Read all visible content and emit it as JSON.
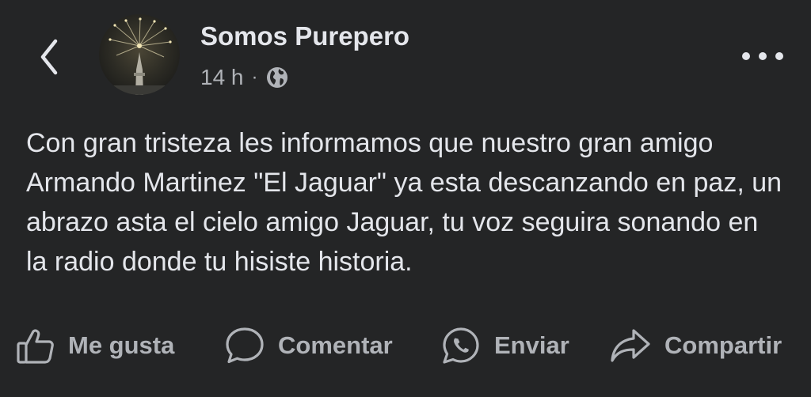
{
  "header": {
    "page_name": "Somos Purepero",
    "time_ago": "14 h",
    "separator": "·",
    "privacy_icon": "globe-icon",
    "back_icon": "chevron-left-icon",
    "more_icon": "more-horizontal-icon"
  },
  "post": {
    "text": "Con gran tristeza les informamos que nuestro gran amigo Armando Martinez \"El Jaguar\" ya esta descanzando en paz, un abrazo asta el cielo amigo Jaguar, tu voz seguira sonando en la radio donde tu hisiste historia."
  },
  "actions": [
    {
      "label": "Me gusta",
      "icon": "thumbs-up-icon"
    },
    {
      "label": "Comentar",
      "icon": "comment-icon"
    },
    {
      "label": "Enviar",
      "icon": "whatsapp-icon"
    },
    {
      "label": "Compartir",
      "icon": "share-icon"
    }
  ],
  "colors": {
    "background": "#242526",
    "primary_text": "#e4e6eb",
    "secondary_text": "#b0b3b8"
  }
}
